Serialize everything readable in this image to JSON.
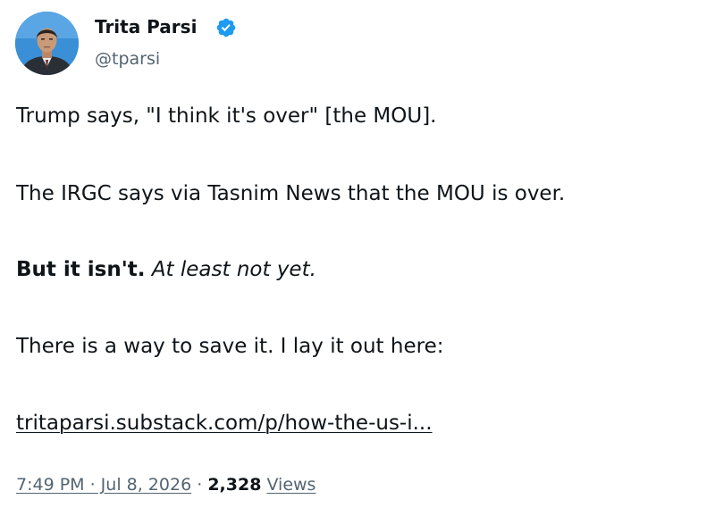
{
  "author": {
    "display_name": "Trita Parsi",
    "handle": "@tparsi",
    "verified": true,
    "avatar_icon": "avatar-photo",
    "badge_icon": "verified-badge-icon",
    "badge_color": "#1d9bf0"
  },
  "tweet": {
    "line1": "Trump says, \"I think it's over\" [the MOU].",
    "line2": "The IRGC says via Tasnim News that the MOU is over.",
    "line3_bold": "But it isn't.",
    "line3_italic": "At least not yet.",
    "line4": "There is a way to save it. I lay it out here:",
    "link_text": "tritaparsi.substack.com/p/how-the-us-i..."
  },
  "meta": {
    "timestamp": "7:49 PM · Jul 8, 2026",
    "separator": "·",
    "views_count": "2,328",
    "views_label": "Views"
  },
  "colors": {
    "text_primary": "#0f1419",
    "text_secondary": "#536471",
    "avatar_bg": "#3a8fd6"
  }
}
